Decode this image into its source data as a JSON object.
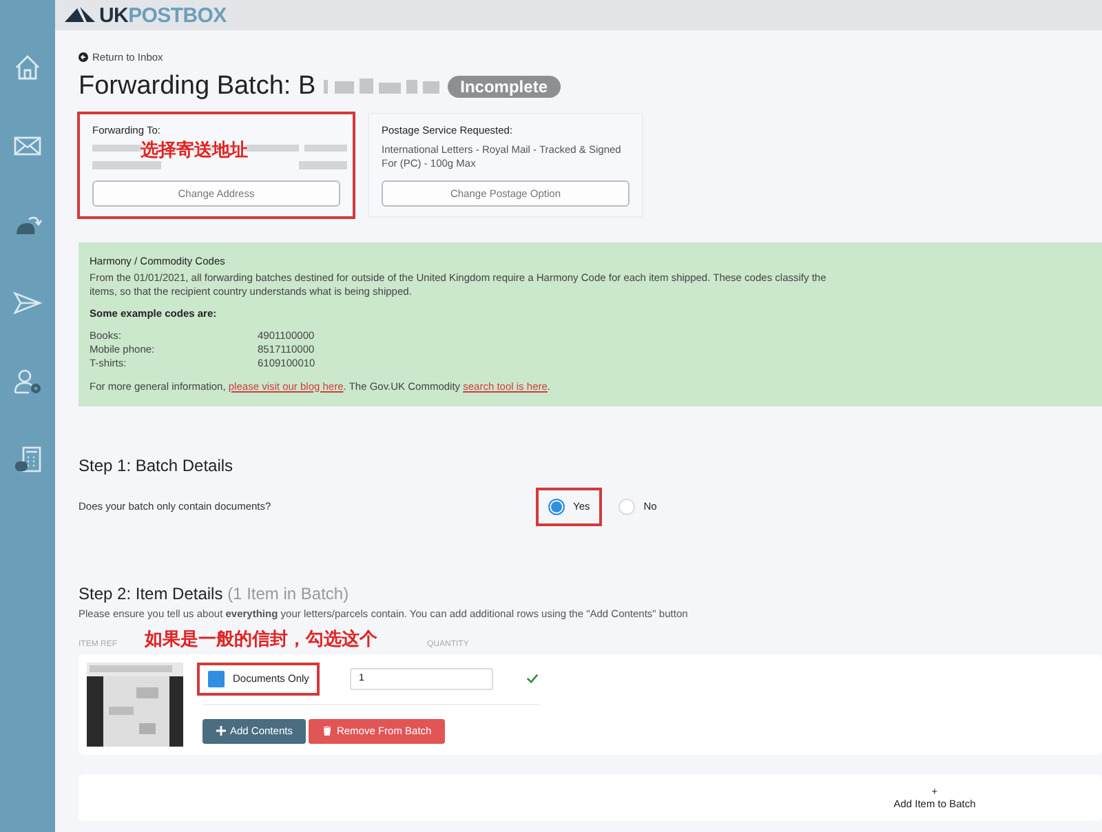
{
  "header": {
    "logo_prefix": "UK",
    "logo_suffix": "POSTBOX"
  },
  "sidebar": {
    "items": [
      {
        "kind": "home"
      },
      {
        "kind": "mail"
      },
      {
        "kind": "forward"
      },
      {
        "kind": "send"
      },
      {
        "kind": "account"
      },
      {
        "kind": "calculator"
      }
    ]
  },
  "back_link": "Return to Inbox",
  "title": "Forwarding Batch: B",
  "status_badge": "Incomplete",
  "forwarding_to": {
    "label": "Forwarding To:",
    "annotation": "选择寄送地址",
    "button": "Change Address",
    "highlighted": true
  },
  "postage": {
    "label": "Postage Service Requested:",
    "value": "International Letters - Royal Mail - Tracked & Signed For (PC) - 100g Max",
    "button": "Change Postage Option"
  },
  "notice": {
    "title": "Harmony / Commodity Codes",
    "text": "From the 01/01/2021, all forwarding batches destined for outside of the United Kingdom require a Harmony Code for each item shipped. These codes classify the items, so that the recipient country understands what is being shipped.",
    "examples_heading": "Some example codes are:",
    "examples": [
      {
        "item": "Books:",
        "code": "4901100000"
      },
      {
        "item": "Mobile phone:",
        "code": "8517110000"
      },
      {
        "item": "T-shirts:",
        "code": "6109100010"
      }
    ],
    "footer": [
      {
        "kind": "text",
        "text": "For more general information, "
      },
      {
        "kind": "link",
        "text": "please visit our blog here"
      },
      {
        "kind": "text",
        "text": ". The Gov.UK Commodity "
      },
      {
        "kind": "link",
        "text": "search tool is here"
      },
      {
        "kind": "text",
        "text": "."
      }
    ]
  },
  "step1": {
    "heading": "Step 1: Batch Details",
    "question": "Does your batch only contain documents?",
    "options": [
      {
        "label": "Yes",
        "selected": true,
        "highlighted": true
      },
      {
        "label": "No",
        "selected": false,
        "highlighted": false
      }
    ]
  },
  "step2": {
    "heading": "Step 2: Item Details",
    "count": "(1 Item in Batch)",
    "description": "Please ensure you tell us about **everything** your letters/parcels contain. You can add additional rows using the \"Add Contents\" button",
    "columns": [
      "ITEM REF",
      "QUANTITY"
    ],
    "annotation": "如果是一般的信封，勾选这个",
    "items": [
      {
        "documents_only_label": "Documents Only",
        "checked": true,
        "highlighted": true,
        "quantity": "1",
        "valid": true,
        "add_button": "Add Contents",
        "remove_button": "Remove From Batch"
      }
    ]
  },
  "add_item": {
    "plus": "+",
    "label": "Add Item to Batch"
  }
}
